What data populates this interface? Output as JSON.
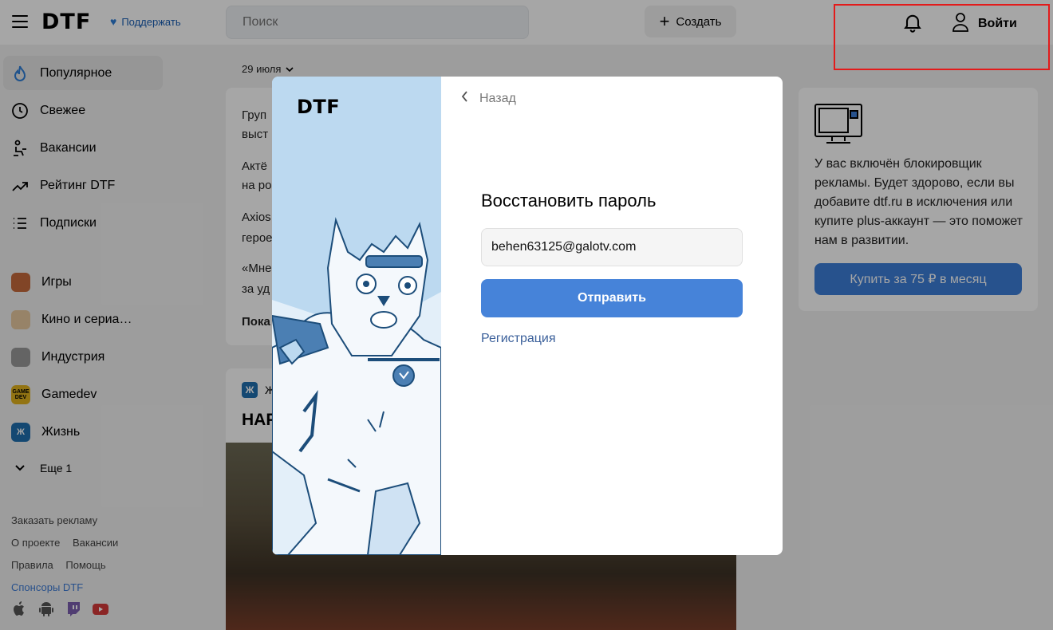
{
  "header": {
    "logo": "DTF",
    "support_label": "Поддержать",
    "search_placeholder": "Поиск",
    "create_label": "Создать",
    "login_label": "Войти"
  },
  "sidebar": {
    "nav": [
      {
        "label": "Популярное",
        "icon": "fire-icon"
      },
      {
        "label": "Свежее",
        "icon": "clock-icon"
      },
      {
        "label": "Вакансии",
        "icon": "person-sit-icon"
      },
      {
        "label": "Рейтинг DTF",
        "icon": "trend-icon"
      },
      {
        "label": "Подписки",
        "icon": "list-icon"
      }
    ],
    "subsites": [
      {
        "label": "Игры",
        "icon": "games-avatar"
      },
      {
        "label": "Кино и сериа…",
        "icon": "popcorn-avatar"
      },
      {
        "label": "Индустрия",
        "icon": "industry-avatar"
      },
      {
        "label": "Gamedev",
        "icon": "gamedev-avatar",
        "badge": "GAME DEV"
      },
      {
        "label": "Жизнь",
        "icon": "life-avatar",
        "badge": "Ж"
      }
    ],
    "more_label": "Еще 1",
    "footer": {
      "ads": "Заказать рекламу",
      "about": "О проекте",
      "jobs": "Вакансии",
      "rules": "Правила",
      "help": "Помощь",
      "sponsors": "Спонсоры DTF"
    }
  },
  "feed": {
    "date": "29 июля",
    "lines": [
      "Груп",
      "выст",
      "Актё",
      "на ро",
      "Axios",
      "герое",
      "«Мне",
      "за уд",
      "Пока"
    ],
    "card2_badge": "Ж",
    "card2_author_start": "Ж",
    "card2_title_start": "НАР"
  },
  "adblock": {
    "text": "У вас включён блокировщик рекламы. Будет здорово, если вы добавите dtf.ru в исключения или купите plus-аккаунт — это поможет нам в развитии.",
    "buy_label": "Купить за 75 ₽ в месяц"
  },
  "modal": {
    "logo": "DTF",
    "back_label": "Назад",
    "title": "Восстановить пароль",
    "email_value": "behen63125@galotv.com",
    "submit_label": "Отправить",
    "register_label": "Регистрация"
  },
  "colors": {
    "accent": "#4683d9",
    "highlight": "#e31b1b",
    "modal_art_bg": "#bcd9f0"
  }
}
